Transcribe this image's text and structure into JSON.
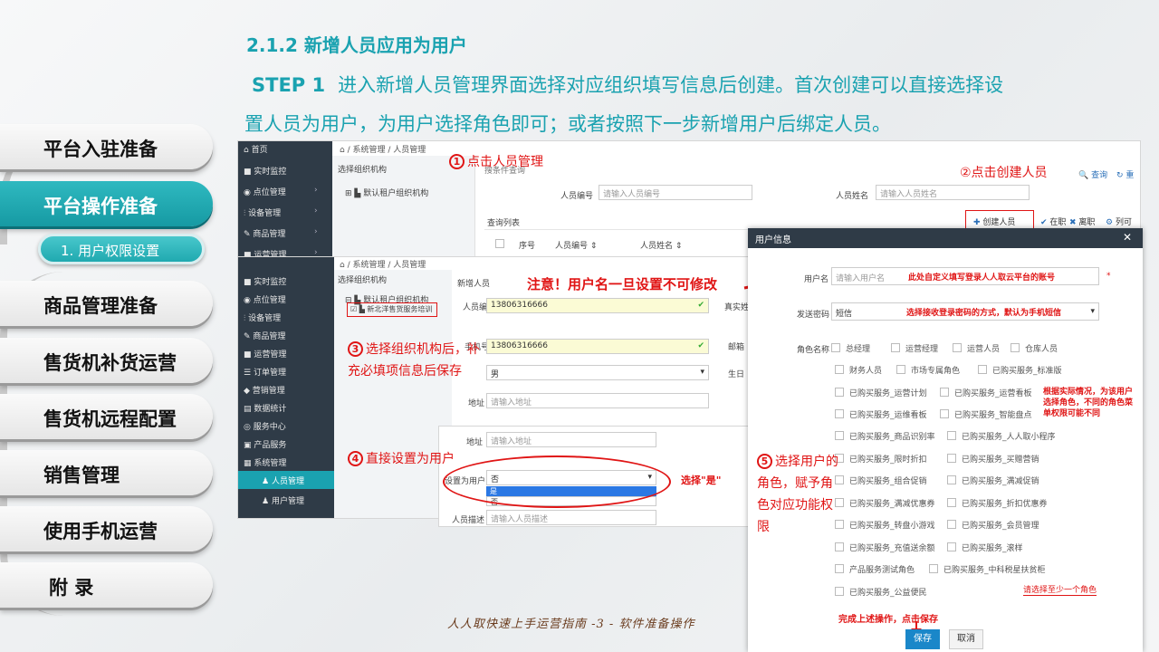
{
  "nav": {
    "items": [
      {
        "label": "平台入驻准备"
      },
      {
        "label": "平台操作准备"
      },
      {
        "label": "商品管理准备"
      },
      {
        "label": "售货机补货运营"
      },
      {
        "label": "售货机远程配置"
      },
      {
        "label": "销售管理"
      },
      {
        "label": "使用手机运营"
      },
      {
        "label": "附 录"
      }
    ],
    "sub": "1. 用户权限设置"
  },
  "heading": "2.1.2 新增人员应用为用户",
  "step": {
    "label": "STEP 1",
    "line1": "进入新增人员管理界面选择对应组织填写信息后创建。首次创建可以直接选择设",
    "line2": "置人员为用户，为用户选择角色即可；或者按照下一步新增用户后绑定人员。"
  },
  "shot1": {
    "sidebar": [
      "首页",
      "实时监控",
      "点位管理",
      "设备管理",
      "商品管理",
      "运营管理"
    ],
    "breadcrumb": "系统管理 / 人员管理",
    "org_title": "选择组织机构",
    "org_root": "默认租户组织机构",
    "query_cond": "搜条件查询",
    "emp_no_label": "人员编号",
    "emp_no_ph": "请输入人员编号",
    "emp_name_label": "人员姓名",
    "emp_name_ph": "请输入人员姓名",
    "search": "查询",
    "reset": "重",
    "list_title": "查询列表",
    "create_btn": "创建人员",
    "on_job": "在职",
    "leave": "离职",
    "cols": "列可",
    "col_no": "序号",
    "col_emp_no": "人员编号 ⇕",
    "col_emp_name": "人员姓名 ⇕"
  },
  "shot2": {
    "sidebar": [
      "实时监控",
      "点位管理",
      "设备管理",
      "商品管理",
      "运营管理",
      "订单管理",
      "营销管理",
      "数据统计",
      "服务中心",
      "产品服务",
      "系统管理",
      "人员管理",
      "用户管理"
    ],
    "breadcrumb": "系统管理 / 人员管理",
    "org_title": "选择组织机构",
    "org_root": "默认租户组织机构",
    "org_child": "新北洋售货服务培训",
    "form_title": "新增人员",
    "emp_no_label": "人员编号",
    "emp_no_val": "13806316666",
    "phone_label": "手机号",
    "phone_val": "13806316666",
    "real_name": "真实姓名",
    "email": "邮箱",
    "birthday": "生日",
    "gender_val": "男",
    "addr_label": "地址",
    "addr_ph": "请输入地址"
  },
  "shot3": {
    "addr_label": "地址",
    "addr_ph": "请输入地址",
    "setuser_label": "设置为用户",
    "setuser_val": "否",
    "opt_yes": "是",
    "opt_no": "否",
    "desc_label": "人员描述",
    "desc_ph": "请输入人员描述"
  },
  "modal": {
    "title": "用户信息",
    "close": "✕",
    "username_label": "用户名",
    "username_ph": "请输入用户名",
    "username_note": "此处自定义填写登录人人取云平台的账号",
    "send_pwd_label": "发送密码",
    "send_pwd_val": "短信",
    "send_pwd_note": "选择接收登录密码的方式，默认为手机短信",
    "roles_label": "角色名称",
    "roles": [
      "总经理",
      "运营经理",
      "运营人员",
      "仓库人员",
      "财务人员",
      "市场专属角色",
      "已购买服务_标准版",
      "已购买服务_运营计划",
      "已购买服务_运营看板",
      "已购买服务_运维看板",
      "已购买服务_智能盘点",
      "已购买服务_商品识别率",
      "已购买服务_人人取小程序",
      "已购买服务_限时折扣",
      "已购买服务_买赠营销",
      "已购买服务_组合促销",
      "已购买服务_满减促销",
      "已购买服务_满减优惠券",
      "已购买服务_折扣优惠券",
      "已购买服务_转盘小游戏",
      "已购买服务_会员管理",
      "已购买服务_充值送余额",
      "已购买服务_滚样",
      "产品服务测试角色",
      "已购买服务_中科税星扶贫柜",
      "已购买服务_公益便民"
    ],
    "role_warning": "请选择至少一个角色",
    "role_note": "根据实际情况，为该用户选择角色，不同的角色菜单权限可能不同",
    "save": "保存",
    "cancel": "取消"
  },
  "annotations": {
    "a1": "点击人员管理",
    "a2": "②点击创建人员",
    "a3": "选择组织机构后，补充必填项信息后保存",
    "a4": "直接设置为用户",
    "a5": "选择用户的角色，赋予角色对应功能权限",
    "notice": "注意！用户名一旦设置不可修改",
    "choose_yes": "选择\"是\"",
    "finish": "完成上述操作，点击保存"
  },
  "footer": "人人取快速上手运营指南 -3 - 软件准备操作",
  "colors": {
    "accent": "#1aa2b0",
    "annotation": "#e01515",
    "sidebar_dark": "#2f3b47"
  }
}
